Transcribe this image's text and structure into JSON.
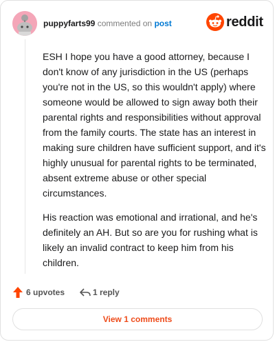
{
  "comment": {
    "author": "puppyfarts99",
    "action_text": "commented on",
    "post_link_text": "post",
    "paragraphs": [
      "ESH I hope you have a good attorney, because I don't know of any jurisdiction in the US (perhaps you're not in the US, so this wouldn't apply) where someone would be allowed to sign away both their parental rights and responsibilities without approval from the family courts. The state has an interest in making sure children have sufficient support, and it's highly unusual for parental rights to be terminated, absent extreme abuse or other special circumstances.",
      "His reaction was emotional and irrational, and he's definitely an AH. But so are you for rushing what is likely an invalid contract to keep him from his children."
    ]
  },
  "brand": {
    "name": "reddit",
    "icon": "reddit-snoo-icon",
    "color": "#ff4500"
  },
  "actions": {
    "upvotes_label": "6 upvotes",
    "upvote_icon": "upvote-arrow-icon",
    "upvote_color": "#ff4500",
    "reply_label": "1 reply",
    "reply_icon": "reply-arrow-icon"
  },
  "view_comments_label": "View 1 comments",
  "colors": {
    "link": "#0079d3",
    "accent": "#ee4b1a",
    "avatar_bg": "#f4a6b8"
  }
}
